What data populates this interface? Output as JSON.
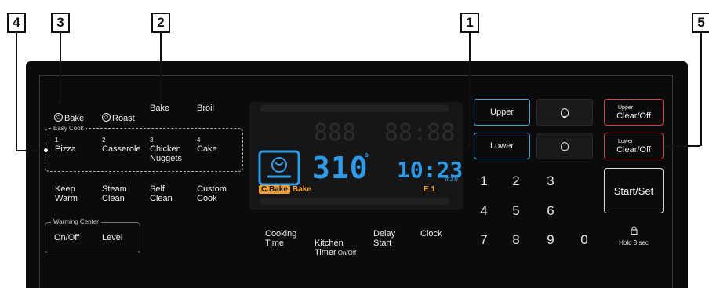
{
  "callouts": [
    "4",
    "3",
    "2",
    "1",
    "5"
  ],
  "cook_modes": {
    "conv_bake": "Bake",
    "conv_roast": "Roast",
    "bake": "Bake",
    "broil": "Broil"
  },
  "easy_cook": {
    "title": "Easy Cook",
    "items": [
      {
        "num": "1",
        "label": "Pizza"
      },
      {
        "num": "2",
        "label": "Casserole"
      },
      {
        "num": "3",
        "label": "Chicken\nNuggets"
      },
      {
        "num": "4",
        "label": "Cake"
      }
    ]
  },
  "functions": [
    {
      "label": "Keep\nWarm"
    },
    {
      "label": "Steam\nClean"
    },
    {
      "label": "Self\nClean"
    },
    {
      "label": "Custom\nCook"
    }
  ],
  "warming_center": {
    "title": "Warming Center",
    "on_off": "On/Off",
    "level": "Level"
  },
  "timers": [
    {
      "label": "Cooking\nTime"
    },
    {
      "label": "Kitchen\nTimer",
      "suffix": "On/Off"
    },
    {
      "label": "Delay\nStart"
    },
    {
      "label": "Clock"
    }
  ],
  "display": {
    "temperature": "310",
    "degree": "°",
    "time": "10:23",
    "time_unit": "min",
    "mode_badge": "C.Bake",
    "mode_text": "Bake",
    "code": "E 1",
    "ghost_digits": "888",
    "ghost_time": "88:88"
  },
  "oven_select": {
    "upper": "Upper",
    "lower": "Lower"
  },
  "clear_buttons": {
    "upper_small": "Upper",
    "upper_main": "Clear/Off",
    "lower_small": "Lower",
    "lower_main": "Clear/Off"
  },
  "keypad": [
    "1",
    "2",
    "3",
    "4",
    "5",
    "6",
    "7",
    "8",
    "9",
    "0"
  ],
  "start_set": "Start/Set",
  "lock": {
    "label": "Hold 3 sec"
  },
  "icons": {
    "light_upper": "light-bulb-icon",
    "light_lower": "light-bulb-icon",
    "lock": "lock-icon",
    "convection": "fan-icon"
  },
  "colors": {
    "panel": "#0b0b0b",
    "display_blue": "#2f9be8",
    "accent_orange": "#f0a030",
    "clear_red": "#d64040",
    "select_blue": "#4aa3d9"
  }
}
